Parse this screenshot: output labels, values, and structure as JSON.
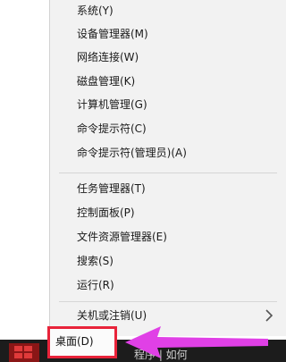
{
  "menu": {
    "items": [
      {
        "label": "系统(Y)"
      },
      {
        "label": "设备管理器(M)"
      },
      {
        "label": "网络连接(W)"
      },
      {
        "label": "磁盘管理(K)"
      },
      {
        "label": "计算机管理(G)"
      },
      {
        "label": "命令提示符(C)"
      },
      {
        "label": "命令提示符(管理员)(A)"
      },
      {
        "label": "任务管理器(T)"
      },
      {
        "label": "控制面板(P)"
      },
      {
        "label": "文件资源管理器(E)"
      },
      {
        "label": "搜索(S)"
      },
      {
        "label": "运行(R)"
      },
      {
        "label": "关机或注销(U)"
      }
    ],
    "desktop_label": "桌面(D)"
  },
  "taskbar": {
    "apps_text": "程序 | 如何"
  },
  "colors": {
    "highlight_border": "#e8233a",
    "arrow": "#e040e6",
    "menu_bg": "#f2f2f2",
    "taskbar_bg": "#1c1c1c"
  },
  "icons": {
    "submenu": "chevron-right-icon",
    "start": "windows-logo-icon",
    "pointer": "arrow-left-icon"
  }
}
